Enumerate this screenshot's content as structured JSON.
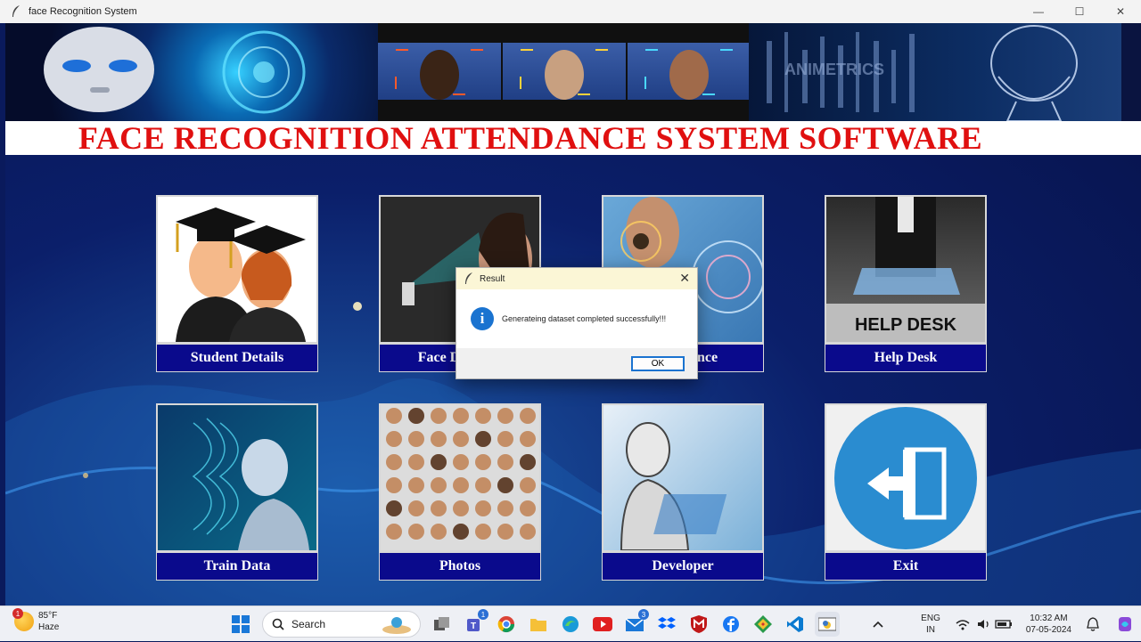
{
  "window": {
    "title": "face Recognition System",
    "minimize": "—",
    "maximize": "☐",
    "close": "✕"
  },
  "header": {
    "title": "FACE RECOGNITION ATTENDANCE SYSTEM SOFTWARE"
  },
  "banner_hud_text": "ANIMETRICS",
  "tiles": [
    {
      "label": "Student Details"
    },
    {
      "label": "Face Detector"
    },
    {
      "label": "Attendance"
    },
    {
      "label": "Help Desk"
    },
    {
      "label": "Train Data"
    },
    {
      "label": "Photos"
    },
    {
      "label": "Developer"
    },
    {
      "label": "Exit"
    }
  ],
  "help_desk_sign": "HELP DESK",
  "dialog": {
    "title": "Result",
    "close": "✕",
    "icon": "i",
    "message": "Generateing dataset completed successfully!!!",
    "ok": "OK"
  },
  "taskbar": {
    "weather_temp": "85°F",
    "weather_desc": "Haze",
    "weather_badge": "1",
    "search_label": "Search",
    "teams_badge": "1",
    "mail_badge": "3",
    "lang_1": "ENG",
    "lang_2": "IN",
    "time": "10:32 AM",
    "date": "07-05-2024"
  },
  "colors": {
    "title_red": "#e01010",
    "label_navy": "#0a0a8c",
    "accent_blue": "#1a73d0"
  }
}
